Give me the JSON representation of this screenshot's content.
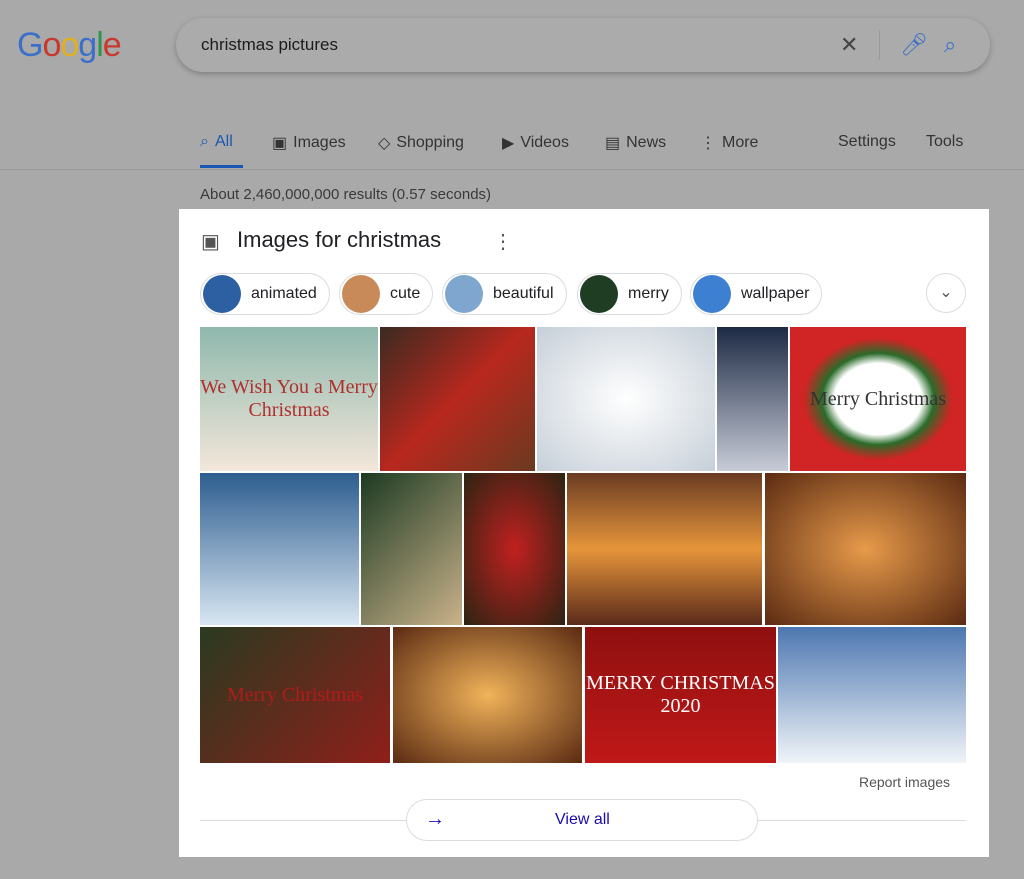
{
  "logo": "Google",
  "search": {
    "query": "christmas pictures",
    "clear_icon": "close-icon",
    "mic_icon": "mic-icon",
    "search_icon": "search-icon"
  },
  "tabs": [
    {
      "label": "All",
      "icon": "search-icon",
      "active": true
    },
    {
      "label": "Images",
      "icon": "image-icon"
    },
    {
      "label": "Shopping",
      "icon": "tag-icon"
    },
    {
      "label": "Videos",
      "icon": "play-icon"
    },
    {
      "label": "News",
      "icon": "news-icon"
    },
    {
      "label": "More",
      "icon": "more-vert-icon"
    }
  ],
  "settings": "Settings",
  "tools": "Tools",
  "stats": "About 2,460,000,000 results (0.57 seconds)",
  "panel": {
    "title": "Images for christmas",
    "chips": [
      {
        "label": "animated",
        "color": "#2d5fa3"
      },
      {
        "label": "cute",
        "color": "#c98a5a"
      },
      {
        "label": "beautiful",
        "color": "#7fa6cf"
      },
      {
        "label": "merry",
        "color": "#1f3d22"
      },
      {
        "label": "wallpaper",
        "color": "#3d7fd0"
      }
    ],
    "images": [
      {
        "bg": "linear-gradient(#8fb8ad,#f3e7da)",
        "text": "We Wish You a Merry Christmas",
        "tc": "#b0302d"
      },
      {
        "bg": "linear-gradient(135deg,#3a2a20,#b8281e,#6a3a20)",
        "text": ""
      },
      {
        "bg": "radial-gradient(#ffffff,#c6cfd8)",
        "text": ""
      },
      {
        "bg": "linear-gradient(#1d2a44,#c8ccd8)",
        "text": ""
      },
      {
        "bg": "radial-gradient(#ffffff 35%,#2a6b2a 45%,#d12424 60%)",
        "text": "Merry Christmas",
        "tc": "#333"
      },
      {
        "bg": "linear-gradient(#2d5d8f,#d8e6f2)",
        "text": ""
      },
      {
        "bg": "linear-gradient(135deg,#1c3a22,#c9b28a)",
        "text": ""
      },
      {
        "bg": "radial-gradient(#c12020,#2b2412)",
        "text": ""
      },
      {
        "bg": "linear-gradient(#6a3b22,#e6953a,#5a2a1a)",
        "text": ""
      },
      {
        "bg": "radial-gradient(#e79a4a,#5a2a12)",
        "text": ""
      },
      {
        "bg": "linear-gradient(135deg,#2a3a20,#8f1f1a)",
        "text": "Merry Christmas",
        "tc": "#b01c1c"
      },
      {
        "bg": "radial-gradient(#f1b35a,#5a2a12)",
        "text": ""
      },
      {
        "bg": "linear-gradient(#8f1010,#c01818)",
        "text": "MERRY CHRISTMAS 2020",
        "tc": "#fff"
      },
      {
        "bg": "linear-gradient(#4d77b0,#f0f4f8)",
        "text": ""
      }
    ],
    "report": "Report images",
    "view_all": "View all",
    "more_icon": "more-vert-icon",
    "expand_icon": "chevron-down-icon"
  }
}
